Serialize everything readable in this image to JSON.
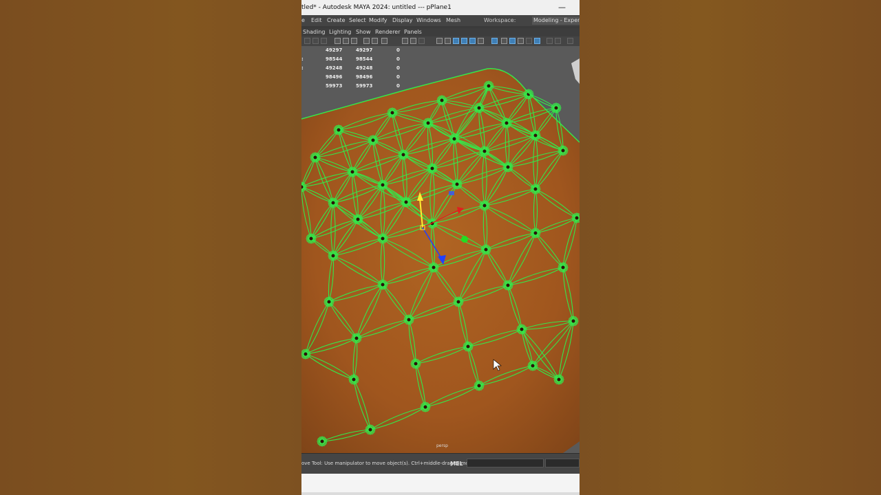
{
  "window": {
    "title": "tled* - Autodesk MAYA 2024: untitled  ---  pPlane1",
    "minimize_glyph": "—"
  },
  "menubar": {
    "items": [
      "e",
      "Edit",
      "Create",
      "Select",
      "Modify",
      "Display",
      "Windows",
      "Mesh"
    ],
    "workspace_label": "Workspace:",
    "workspace_value": "Modeling - Expert*"
  },
  "panel_menu": {
    "items": [
      "Shading",
      "Lighting",
      "Show",
      "Renderer",
      "Panels"
    ]
  },
  "hud": {
    "rows": [
      {
        "c1": "",
        "c2": "49297",
        "c3": "49297",
        "c4": "0"
      },
      {
        "c1": ":",
        "c2": "98544",
        "c3": "98544",
        "c4": "0"
      },
      {
        "c1": ":",
        "c2": "49248",
        "c3": "49248",
        "c4": "0"
      },
      {
        "c1": "",
        "c2": "98496",
        "c3": "98496",
        "c4": "0"
      },
      {
        "c1": "",
        "c2": "59973",
        "c3": "59973",
        "c4": "0"
      }
    ]
  },
  "viewport": {
    "camera_label": "persp",
    "wire_color": "#34e84a",
    "surface_color": "#a0561e"
  },
  "statusbar": {
    "help_text": "ove Tool: Use manipulator to move object(s). Ctrl+middle-drag to move",
    "mel_label": "MEL"
  },
  "colors": {
    "accent_blue": "#3f7fb6",
    "manip_y": "#ffee33",
    "manip_x": "#e02020",
    "manip_z": "#2040ff",
    "manip_center": "#22dd22"
  },
  "icons": {
    "toolbar": [
      "select-tool-icon",
      "lasso-icon",
      "paint-select-icon",
      "move-icon",
      "rotate-icon",
      "scale-icon",
      "grid-icon",
      "camera-icon",
      "frame-icon",
      "wireframe-icon",
      "shaded-icon",
      "textured-icon",
      "lights-icon",
      "shadows-icon",
      "isolate-icon",
      "xray-icon"
    ]
  }
}
